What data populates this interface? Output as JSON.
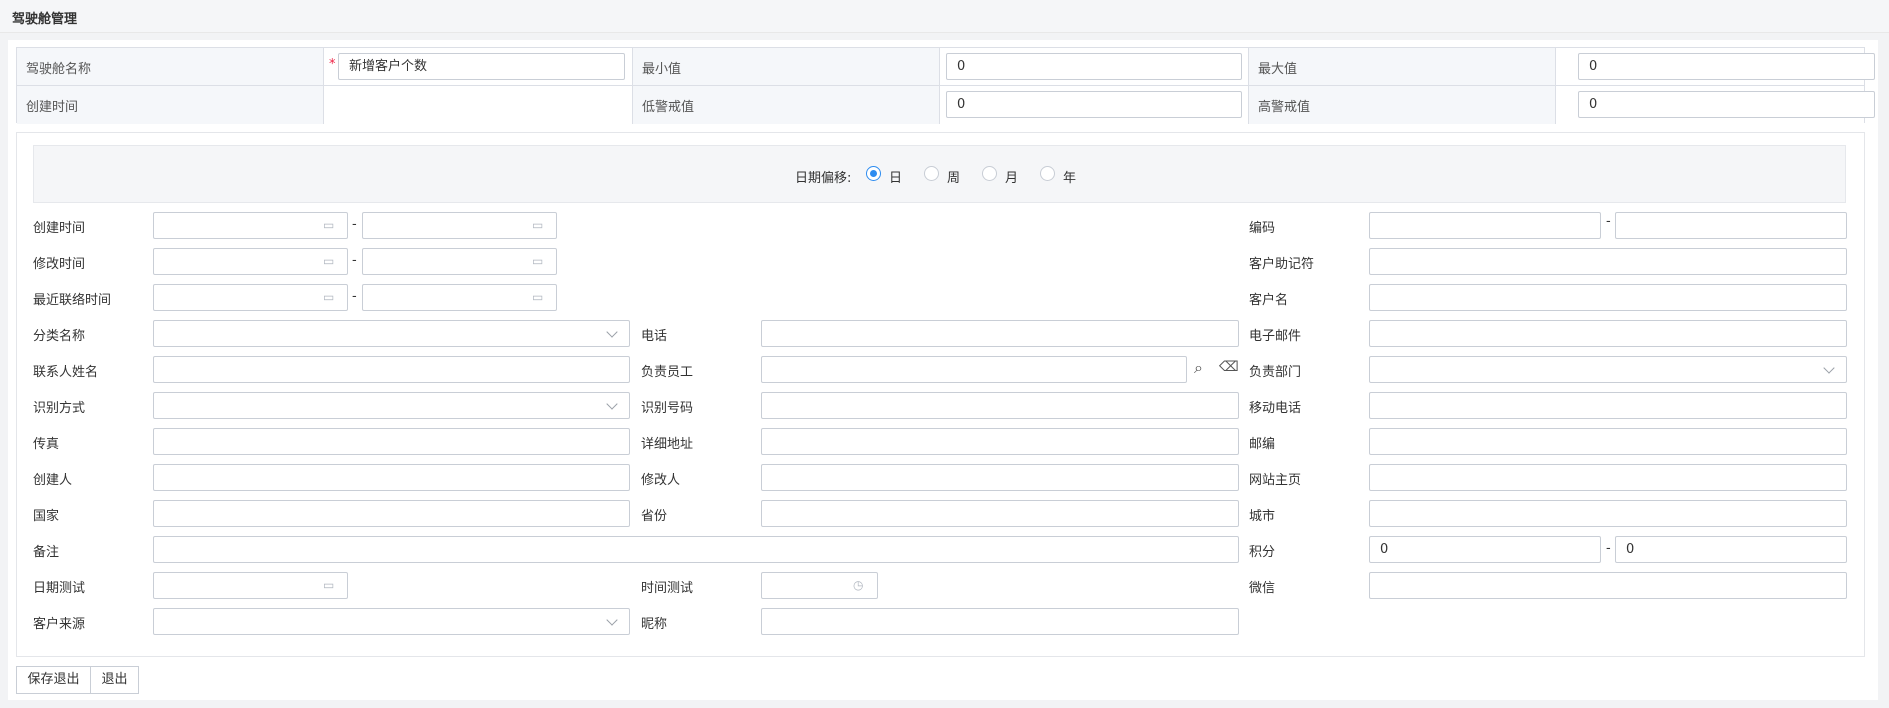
{
  "page_title": "驾驶舱管理",
  "header": {
    "name_label": "驾驶舱名称",
    "name_value": "新增客户个数",
    "min_label": "最小值",
    "min_value": "0",
    "max_label": "最大值",
    "max_value": "0",
    "created_label": "创建时间",
    "low_warn_label": "低警戒值",
    "low_warn_value": "0",
    "high_warn_label": "高警戒值",
    "high_warn_value": "0"
  },
  "date_offset": {
    "label": "日期偏移:",
    "options": [
      "日",
      "周",
      "月",
      "年"
    ],
    "selected": "日"
  },
  "form": {
    "create_time": "创建时间",
    "modify_time": "修改时间",
    "last_contact_time": "最近联络时间",
    "category_name": "分类名称",
    "contact_name": "联系人姓名",
    "id_method": "识别方式",
    "fax": "传真",
    "creator": "创建人",
    "country": "国家",
    "remark": "备注",
    "date_test": "日期测试",
    "customer_source": "客户来源",
    "phone": "电话",
    "staff": "负责员工",
    "id_number": "识别号码",
    "address": "详细地址",
    "modifier": "修改人",
    "province": "省份",
    "time_test": "时间测试",
    "nickname": "昵称",
    "code": "编码",
    "mnemonic": "客户助记符",
    "customer_name": "客户名",
    "email": "电子邮件",
    "department": "负责部门",
    "mobile": "移动电话",
    "postcode": "邮编",
    "website": "网站主页",
    "city": "城市",
    "points": "积分",
    "points_from": "0",
    "points_to": "0",
    "wechat": "微信",
    "range_sep": "-"
  },
  "buttons": {
    "save_exit": "保存退出",
    "exit": "退出"
  }
}
